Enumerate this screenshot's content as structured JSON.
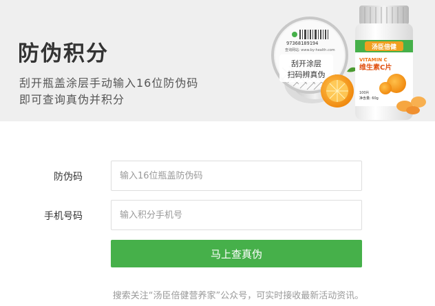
{
  "banner": {
    "title": "防伪积分",
    "line1": "刮开瓶盖涂层手动输入16位防伪码",
    "line2": "即可查询真伪并积分",
    "product": {
      "brand": "汤臣倍健",
      "name_en": "VITAMIN C",
      "name_cn": "维生素C片",
      "count": "100片",
      "net": "净含量: 60g",
      "serial": "97368189194",
      "site": "查询网站: www.by-health.com",
      "bubble1": "刮开涂层",
      "bubble2": "扫码辨真伪"
    }
  },
  "form": {
    "code_label": "防伪码",
    "code_placeholder": "输入16位瓶盖防伪码",
    "phone_label": "手机号码",
    "phone_placeholder": "输入积分手机号",
    "submit_label": "马上查真伪"
  },
  "footer_note": "搜索关注“汤臣倍健营养家”公众号，可实时接收最新活动资讯。",
  "colors": {
    "accent_green": "#46b04a",
    "brand_orange": "#f0a020",
    "banner_bg": "#efefef"
  }
}
